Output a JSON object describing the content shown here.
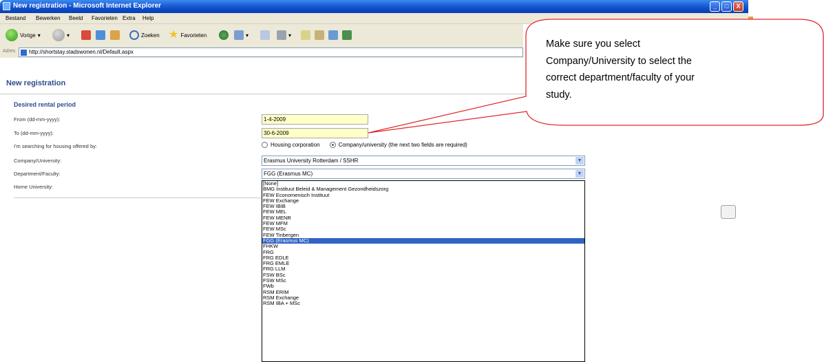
{
  "window": {
    "title": "New registration - Microsoft Internet Explorer",
    "minimize_label": "_",
    "maximize_label": "□",
    "close_label": "X"
  },
  "menu": [
    "Bestand",
    "Bewerken",
    "Beeld",
    "Favorieten",
    "Extra",
    "Help"
  ],
  "toolbar": {
    "back_label": "Vorige",
    "search_label": "Zoeken",
    "favorites_label": "Favorieten"
  },
  "address": {
    "label": "Adres",
    "url": "http://shortstay.stadswonen.nl/Default.aspx"
  },
  "page": {
    "heading": "New registration"
  },
  "form": {
    "section_title": "Desired rental period",
    "from_label": "From (dd-mm-yyyy):",
    "from_value": "1-4-2009",
    "to_label": "To (dd-mm-yyyy):",
    "to_value": "30-6-2009",
    "offered_by_label": "I'm searching for housing offered by:",
    "radio_housing": "Housing corporation",
    "radio_company": "Company/university (the next two fields are required)",
    "company_label": "Company/University:",
    "company_value": "Erasmus University Rotterdam / SSHR",
    "department_label": "Department/Faculty:",
    "department_value": "FGG (Erasmus MC)",
    "home_university_label": "Home University:"
  },
  "dropdown": {
    "options": [
      "[None]",
      "BMG Instituut Beleid & Management Gezondheidszorg",
      "FEW Economenisch Instituut",
      "FEW Exchange",
      "FEW IBIB",
      "FEW MEL",
      "FEW MENR",
      "FEW MFM",
      "FEW MSc",
      "FEW Tinbergen",
      "FGG (Erasmus MC)",
      "FHKW",
      "FRG",
      "FRG EDLE",
      "FRG EMLE",
      "FRG LLM",
      "FSW BSc",
      "FSW MSc",
      "FWb",
      "RSM ERIM",
      "RSM Exchange",
      "RSM IBA + MSc"
    ],
    "selected_index": 10
  },
  "callout": {
    "lines": [
      "Make sure you select",
      "Company/University to select the",
      "correct department/faculty of your",
      "study."
    ],
    "border_color": "#e0262b"
  }
}
